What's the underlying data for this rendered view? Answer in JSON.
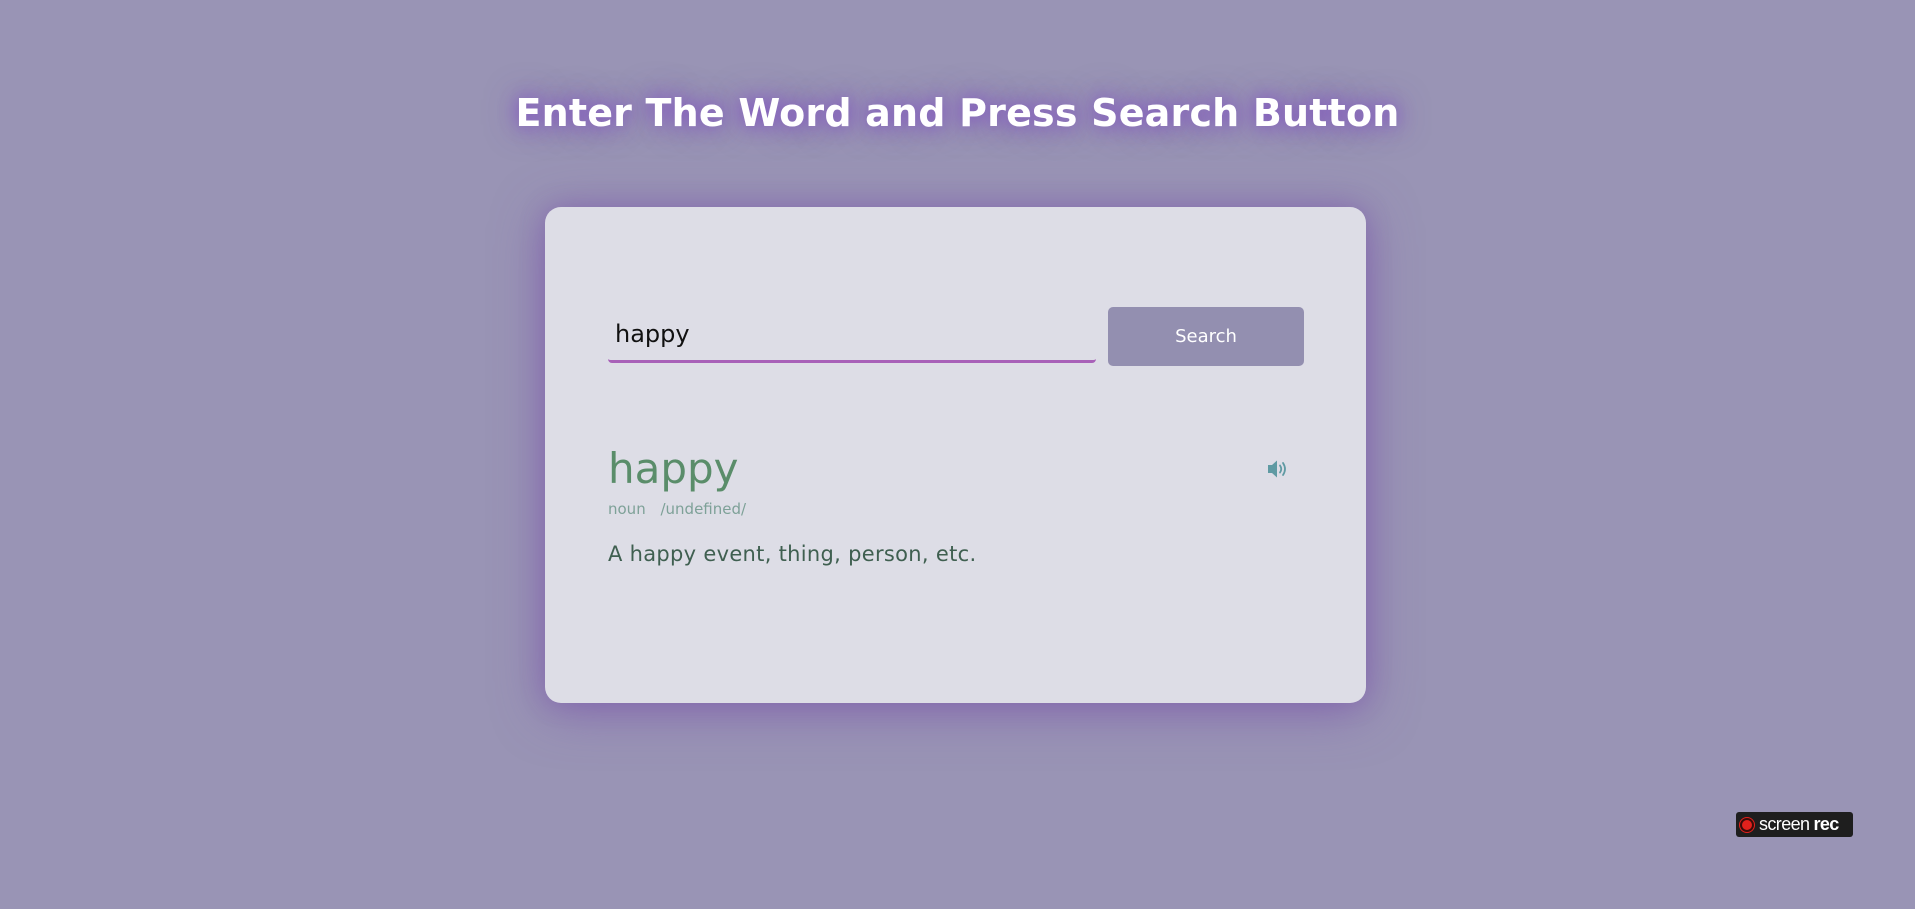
{
  "header": {
    "title": "Enter The Word and Press Search Button"
  },
  "search": {
    "value": "happy",
    "placeholder": "",
    "button_label": "Search"
  },
  "result": {
    "word": "happy",
    "part_of_speech": "noun",
    "phonetic": "/undefined/",
    "definition": "A happy event, thing, person, etc.",
    "sound_icon": "volume-icon"
  },
  "watermark": {
    "text_light": "screen",
    "text_bold": "rec"
  },
  "colors": {
    "background": "#9994b5",
    "card": "#dddde6",
    "button": "#938fb0",
    "input_underline": "#a861b8",
    "word": "#5a8d6a",
    "meta": "#7ea198",
    "definition": "#3f5f50",
    "title_glow": "#7e48c4"
  }
}
